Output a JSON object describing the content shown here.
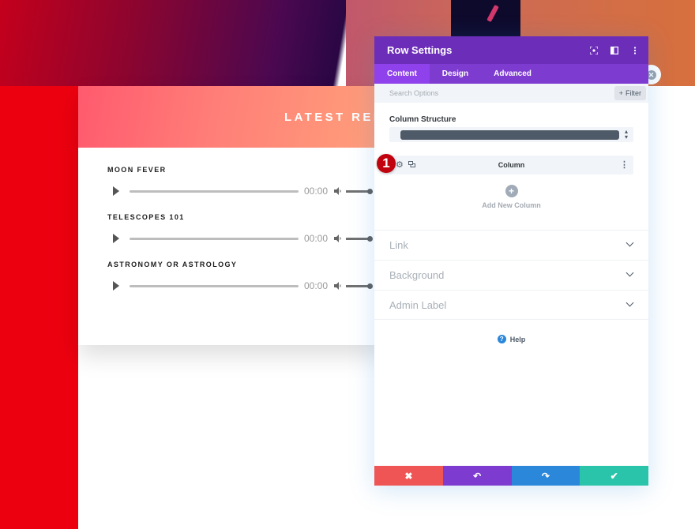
{
  "page": {
    "section_title": "LATEST RELEASES",
    "tracks": [
      {
        "title": "MOON FEVER",
        "time": "00:00"
      },
      {
        "title": "TELESCOPES 101",
        "time": "00:00"
      },
      {
        "title": "ASTRONOMY OR ASTROLOGY",
        "time": "00:00"
      }
    ]
  },
  "panel": {
    "title": "Row Settings",
    "header_icons": [
      "focus-icon",
      "split-view-icon",
      "more-options-icon"
    ],
    "tabs": [
      {
        "label": "Content",
        "active": true
      },
      {
        "label": "Design",
        "active": false
      },
      {
        "label": "Advanced",
        "active": false
      }
    ],
    "search_placeholder": "Search Options",
    "filter_label": "Filter",
    "column_structure_label": "Column Structure",
    "column_label": "Column",
    "add_column_label": "Add New Column",
    "toggles": [
      {
        "label": "Link"
      },
      {
        "label": "Background"
      },
      {
        "label": "Admin Label"
      }
    ],
    "help_label": "Help",
    "badge_number": "1",
    "footer": {
      "cancel_color": "#ef5555",
      "undo_color": "#7d3bcf",
      "redo_color": "#2b87da",
      "save_color": "#29c4a9"
    },
    "accent_color": "#6c2eb9"
  }
}
